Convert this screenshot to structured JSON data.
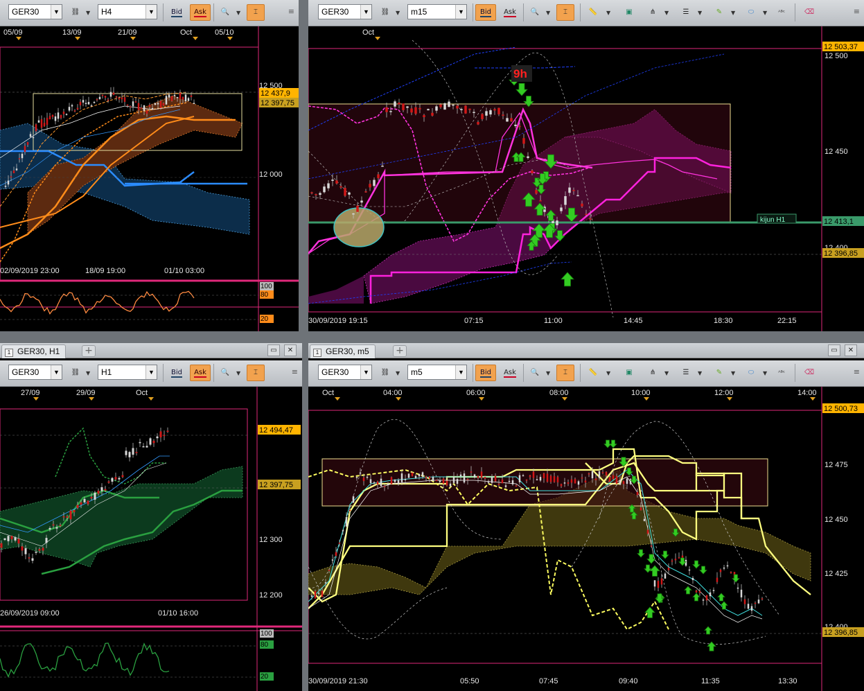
{
  "toolbar": {
    "bid": "Bid",
    "ask": "Ask"
  },
  "panes": {
    "tl": {
      "symbol": "GER30",
      "timeframe": "H4",
      "top_ticks": [
        "05/09",
        "13/09",
        "21/09",
        "Oct",
        "05/10"
      ],
      "bottom_ticks": [
        "02/09/2019 23:00",
        "18/09 19:00",
        "01/10 03:00"
      ],
      "price_ticks": [
        "12 500",
        "12 000"
      ],
      "price_labels": [
        "12 437,9",
        "12 397,75"
      ],
      "osc_levels": [
        "100",
        "80",
        "20"
      ]
    },
    "tr": {
      "symbol": "GER30",
      "timeframe": "m15",
      "top_ticks": [
        "Oct"
      ],
      "bottom_ticks": [
        "30/09/2019 19:15",
        "07:15",
        "11:00",
        "14:45",
        "18:30",
        "22:15"
      ],
      "price_ticks": [
        "12 500",
        "12 450",
        "12 400"
      ],
      "price_labels": [
        "12 503,37",
        "12 413,1",
        "12 396,85"
      ],
      "annotation": "9h",
      "line_label": "kijun H1"
    },
    "bl": {
      "tab": "GER30, H1",
      "symbol": "GER30",
      "timeframe": "H1",
      "top_ticks": [
        "27/09",
        "29/09",
        "Oct"
      ],
      "bottom_ticks": [
        "26/09/2019 09:00",
        "01/10 16:00"
      ],
      "price_ticks": [
        "12 300",
        "12 200"
      ],
      "price_labels": [
        "12 494,47",
        "12 397,75"
      ],
      "osc_levels": [
        "100",
        "80",
        "20"
      ]
    },
    "br": {
      "tab": "GER30, m5",
      "symbol": "GER30",
      "timeframe": "m5",
      "top_ticks": [
        "Oct",
        "04:00",
        "06:00",
        "08:00",
        "10:00",
        "12:00",
        "14:00"
      ],
      "bottom_ticks": [
        "30/09/2019 21:30",
        "05:50",
        "07:45",
        "09:40",
        "11:35",
        "13:30"
      ],
      "price_ticks": [
        "12 475",
        "12 450",
        "12 425",
        "12 400"
      ],
      "price_labels": [
        "12 500,73",
        "12 396,85"
      ]
    }
  },
  "colors": {
    "accent": "#f2a24e",
    "frame": "#e0287a",
    "price_tag": "#ffb400",
    "magenta": "#ff33dd",
    "yellow": "#ffff80",
    "green_arrow": "#33cc22"
  }
}
